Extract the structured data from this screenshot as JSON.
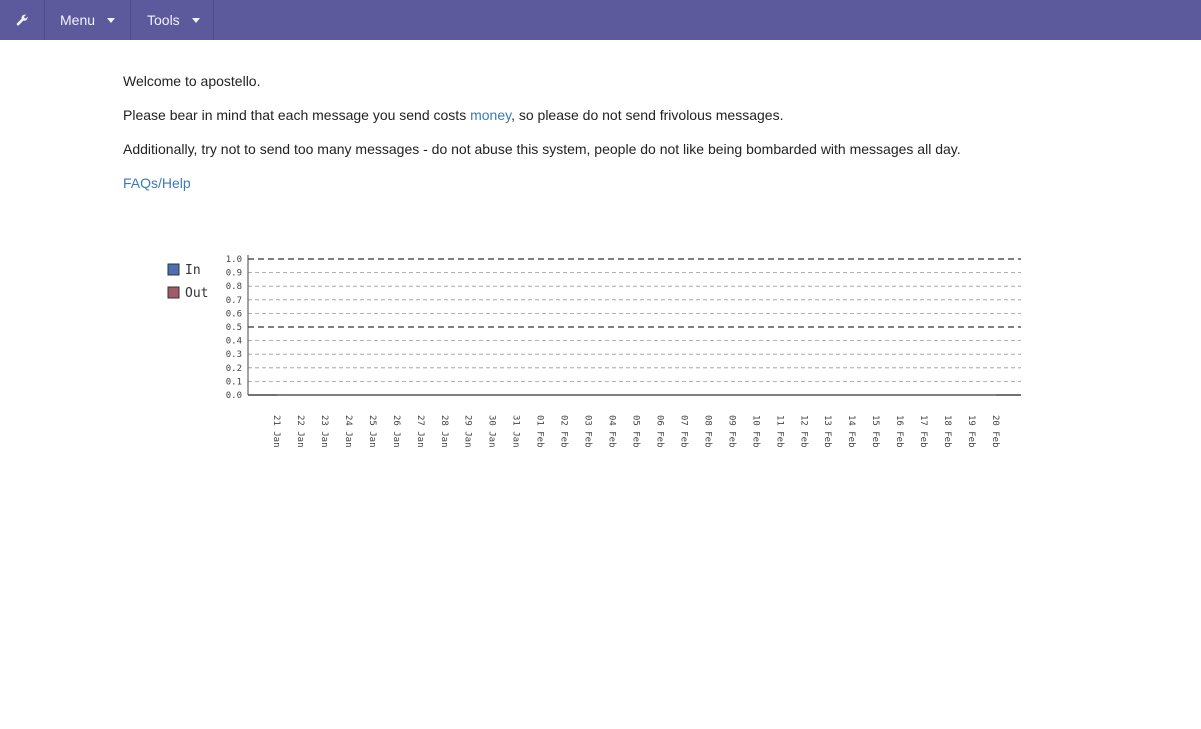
{
  "nav": {
    "tools_icon": "wrench-icon",
    "menu_label": "Menu",
    "tools_label": "Tools"
  },
  "content": {
    "welcome": "Welcome to apostello.",
    "cost_before": "Please bear in mind that each message you send costs ",
    "cost_link": "money",
    "cost_after": ", so please do not send frivolous messages.",
    "abuse": "Additionally, try not to send too many messages - do not abuse this system, people do not like being bombarded with messages all day.",
    "faq_link": "FAQs/Help"
  },
  "colors": {
    "nav_bg": "#5c5a9c",
    "link": "#3b7ab8",
    "in": "#4a6fb5",
    "out": "#a05a6a"
  },
  "chart_data": {
    "type": "line",
    "categories": [
      "21 Jan",
      "22 Jan",
      "23 Jan",
      "24 Jan",
      "25 Jan",
      "26 Jan",
      "27 Jan",
      "28 Jan",
      "29 Jan",
      "30 Jan",
      "31 Jan",
      "01 Feb",
      "02 Feb",
      "03 Feb",
      "04 Feb",
      "05 Feb",
      "06 Feb",
      "07 Feb",
      "08 Feb",
      "09 Feb",
      "10 Feb",
      "11 Feb",
      "12 Feb",
      "13 Feb",
      "14 Feb",
      "15 Feb",
      "16 Feb",
      "17 Feb",
      "18 Feb",
      "19 Feb",
      "20 Feb"
    ],
    "series": [
      {
        "name": "In",
        "values": [
          0,
          0,
          0,
          0,
          0,
          0,
          0,
          0,
          0,
          0,
          0,
          0,
          0,
          0,
          0,
          0,
          0,
          0,
          0,
          0,
          0,
          0,
          0,
          0,
          0,
          0,
          0,
          0,
          0,
          0,
          0
        ]
      },
      {
        "name": "Out",
        "values": [
          0,
          0,
          0,
          0,
          0,
          0,
          0,
          0,
          0,
          0,
          0,
          0,
          0,
          0,
          0,
          0,
          0,
          0,
          0,
          0,
          0,
          0,
          0,
          0,
          0,
          0,
          0,
          0,
          0,
          0,
          0
        ]
      }
    ],
    "yticks": [
      "0.0",
      "0.1",
      "0.2",
      "0.3",
      "0.4",
      "0.5",
      "0.6",
      "0.7",
      "0.8",
      "0.9",
      "1.0"
    ],
    "ylim": [
      0,
      1
    ],
    "grid": true,
    "legend_position": "left"
  }
}
